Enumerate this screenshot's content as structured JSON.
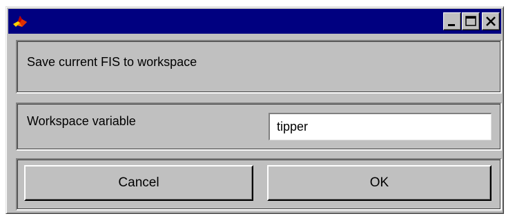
{
  "window": {
    "title": "",
    "title_bar_color": "#000080",
    "app_icon": "matlab-logo-icon",
    "controls": [
      "minimize-icon",
      "maximize-icon",
      "close-icon"
    ]
  },
  "header": {
    "text": "Save current FIS to workspace"
  },
  "variable": {
    "label": "Workspace variable",
    "value": "tipper"
  },
  "buttons": {
    "cancel_label": "Cancel",
    "ok_label": "OK"
  }
}
